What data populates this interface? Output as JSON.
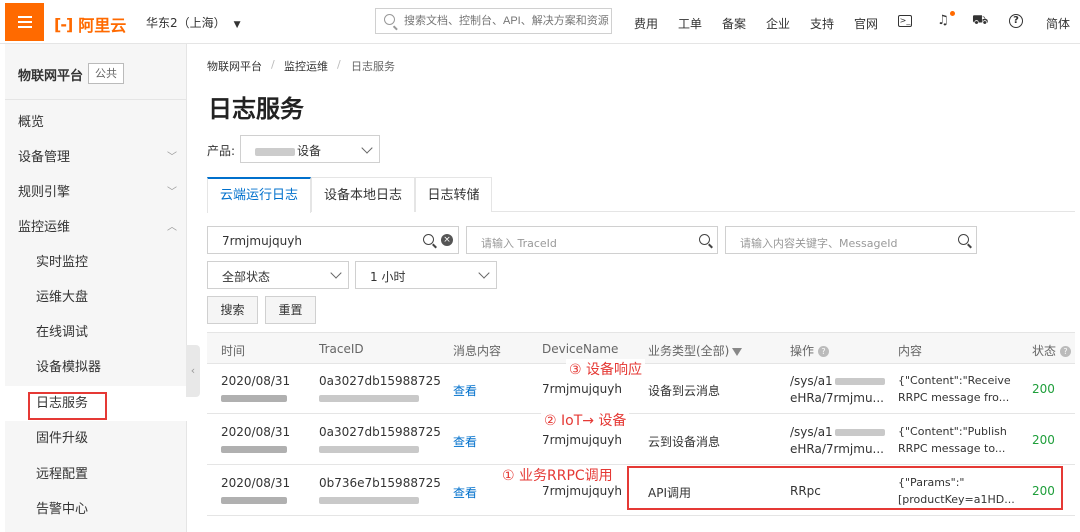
{
  "topbar": {
    "brand": "阿里云",
    "brand_mark": "[-]",
    "region": "华东2（上海）",
    "search_placeholder": "搜索文档、控制台、API、解决方案和资源",
    "nav": [
      "费用",
      "工单",
      "备案",
      "企业",
      "支持",
      "官网"
    ],
    "lang": "简体"
  },
  "sidebar": {
    "title": "物联网平台",
    "badge": "公共",
    "items": [
      {
        "label": "概览"
      },
      {
        "label": "设备管理"
      },
      {
        "label": "规则引擎"
      },
      {
        "label": "监控运维"
      },
      {
        "label": "实时监控"
      },
      {
        "label": "运维大盘"
      },
      {
        "label": "在线调试"
      },
      {
        "label": "设备模拟器"
      },
      {
        "label": "日志服务"
      },
      {
        "label": "固件升级"
      },
      {
        "label": "远程配置"
      },
      {
        "label": "告警中心"
      }
    ]
  },
  "breadcrumb": [
    "物联网平台",
    "监控运维",
    "日志服务"
  ],
  "page_title": "日志服务",
  "product": {
    "label": "产品:",
    "value": "设备"
  },
  "tabs": [
    "云端运行日志",
    "设备本地日志",
    "日志转储"
  ],
  "filters": {
    "device_name": "7rmjmujquyh",
    "trace_placeholder": "请输入 TraceId",
    "keyword_placeholder": "请输入内容关键字、MessageId",
    "status": "全部状态",
    "time_range": "1 小时",
    "search_btn": "搜索",
    "reset_btn": "重置"
  },
  "table": {
    "headers": [
      "时间",
      "TraceID",
      "消息内容",
      "DeviceName",
      "业务类型(全部)",
      "操作",
      "内容",
      "状态"
    ],
    "rows": [
      {
        "time": "2020/08/31",
        "trace": "0a3027db15988725",
        "msg": "查看",
        "device": "7rmjmujquyh",
        "biz": "设备到云消息",
        "op1": "/sys/a1",
        "op2": "eHRa/7rmjmu...",
        "content1": "{\"Content\":\"Receive",
        "content2": "RRPC message fro...",
        "status": "200"
      },
      {
        "time": "2020/08/31",
        "trace": "0a3027db15988725",
        "msg": "查看",
        "device": "7rmjmujquyh",
        "biz": "云到设备消息",
        "op1": "/sys/a1",
        "op2": "eHRa/7rmjmu...",
        "content1": "{\"Content\":\"Publish",
        "content2": "RRPC message to...",
        "status": "200"
      },
      {
        "time": "2020/08/31",
        "trace": "0b736e7b15988725",
        "msg": "查看",
        "device": "7rmjmujquyh",
        "biz": "API调用",
        "op1": "RRpc",
        "op2": "",
        "content1": "{\"Params\":\"",
        "content2": "[productKey=a1HD...",
        "status": "200"
      }
    ]
  },
  "annotations": [
    "③ 设备响应",
    "② IoT→ 设备",
    "① 业务RRPC调用"
  ],
  "colors": {
    "accent": "#ff6a00",
    "link": "#0070cc",
    "status_ok": "#1e9e3a",
    "annotation": "#e53935"
  },
  "icons": [
    "menu-icon",
    "search-icon",
    "terminal-icon",
    "bell-icon",
    "cart-icon",
    "help-icon",
    "chevron-down-icon",
    "chevron-up-icon",
    "clear-icon",
    "help-circle-icon",
    "filter-icon",
    "collapse-icon"
  ]
}
